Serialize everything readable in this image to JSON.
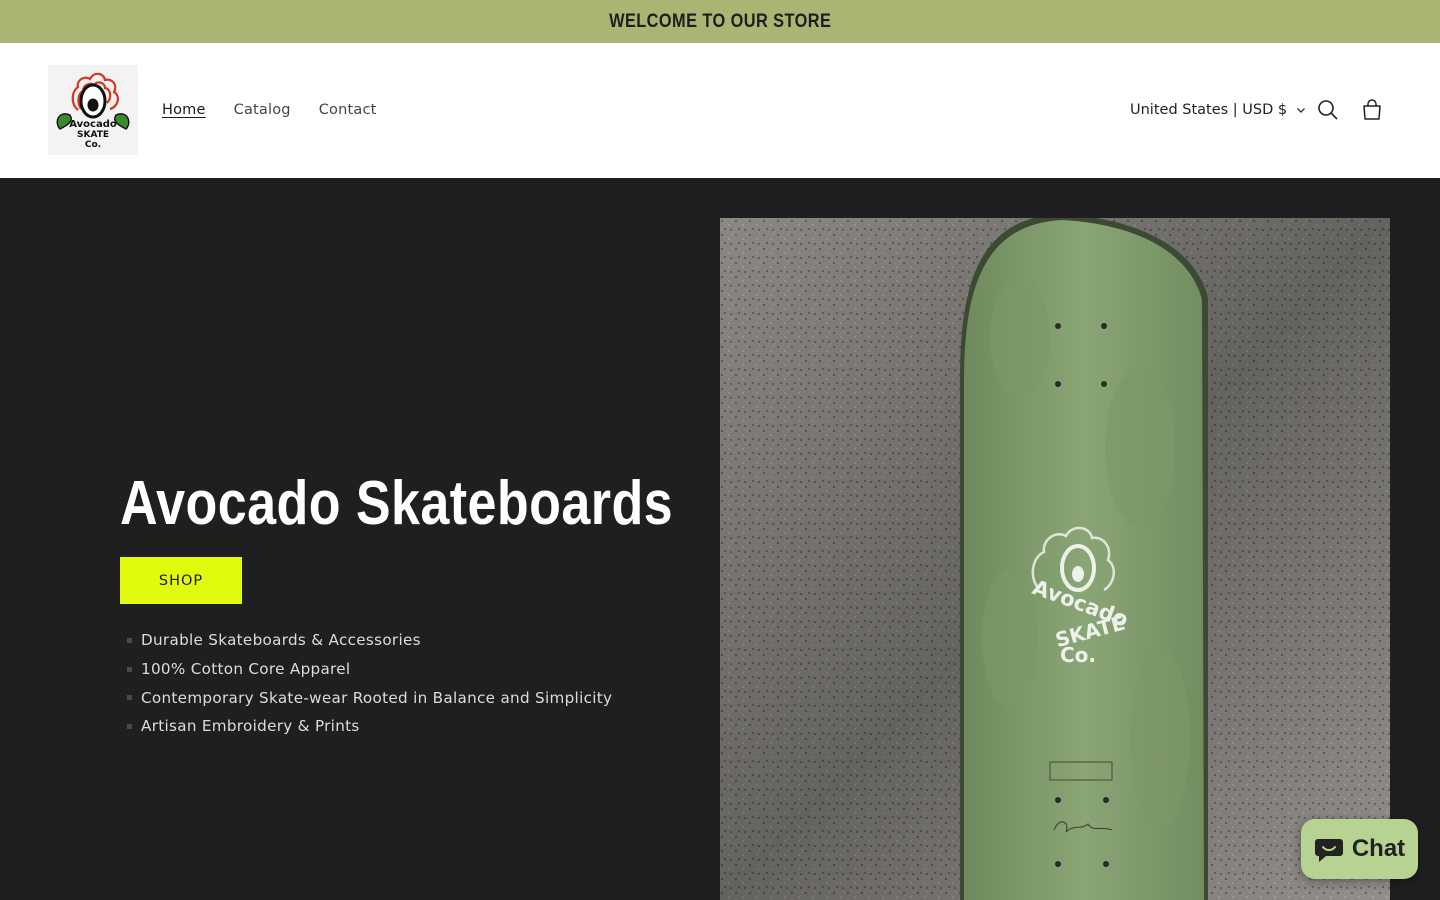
{
  "announcement": {
    "text": "WELCOME TO OUR STORE"
  },
  "header": {
    "logo": {
      "line1": "Avocado",
      "line2": "SKATE",
      "line3": "Co."
    },
    "nav": [
      {
        "label": "Home",
        "active": true
      },
      {
        "label": "Catalog",
        "active": false
      },
      {
        "label": "Contact",
        "active": false
      }
    ],
    "locale": "United States | USD $",
    "icons": [
      "search-icon",
      "cart-icon",
      "chevron-down-icon"
    ]
  },
  "hero": {
    "title": "Avocado Skateboards",
    "button_label": "SHOP",
    "features": [
      "Durable Skateboards & Accessories",
      "100% Cotton Core Apparel",
      "Contemporary Skate-wear Rooted in Balance and Simplicity",
      "Artisan Embroidery & Prints"
    ],
    "image": {
      "deck_line1": "Avocado",
      "deck_line2": "SKATE",
      "deck_line3": "Co."
    }
  },
  "chat": {
    "label": "Chat"
  },
  "colors": {
    "announcement_bg": "#aab573",
    "hero_bg": "#1f1f21",
    "button_bg": "#e2fa0d",
    "chat_bg": "#b6d391",
    "deck_green": "#7f9a6a"
  }
}
